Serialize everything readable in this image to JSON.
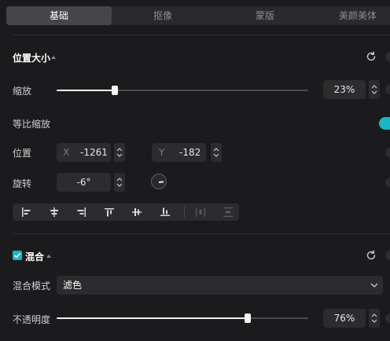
{
  "tabs": [
    "基础",
    "抠像",
    "蒙版",
    "美颜美体"
  ],
  "position_size": {
    "title": "位置大小",
    "scale": {
      "label": "缩放",
      "value_text": "23%",
      "level": 0.23
    },
    "uniform_scale": {
      "label": "等比缩放",
      "enabled": true
    },
    "position": {
      "label": "位置",
      "x_axis": "X",
      "x_value": "-1261",
      "y_axis": "Y",
      "y_value": "-182"
    },
    "rotation": {
      "label": "旋转",
      "value_text": "-6°"
    }
  },
  "blend": {
    "title": "混合",
    "checked": true,
    "mode": {
      "label": "混合模式",
      "value": "滤色"
    },
    "opacity": {
      "label": "不透明度",
      "value_text": "76%",
      "level": 0.76
    }
  },
  "colors": {
    "accent": "#16b7c7",
    "panel": "#1b1b1d",
    "field": "#2c2c2f"
  }
}
